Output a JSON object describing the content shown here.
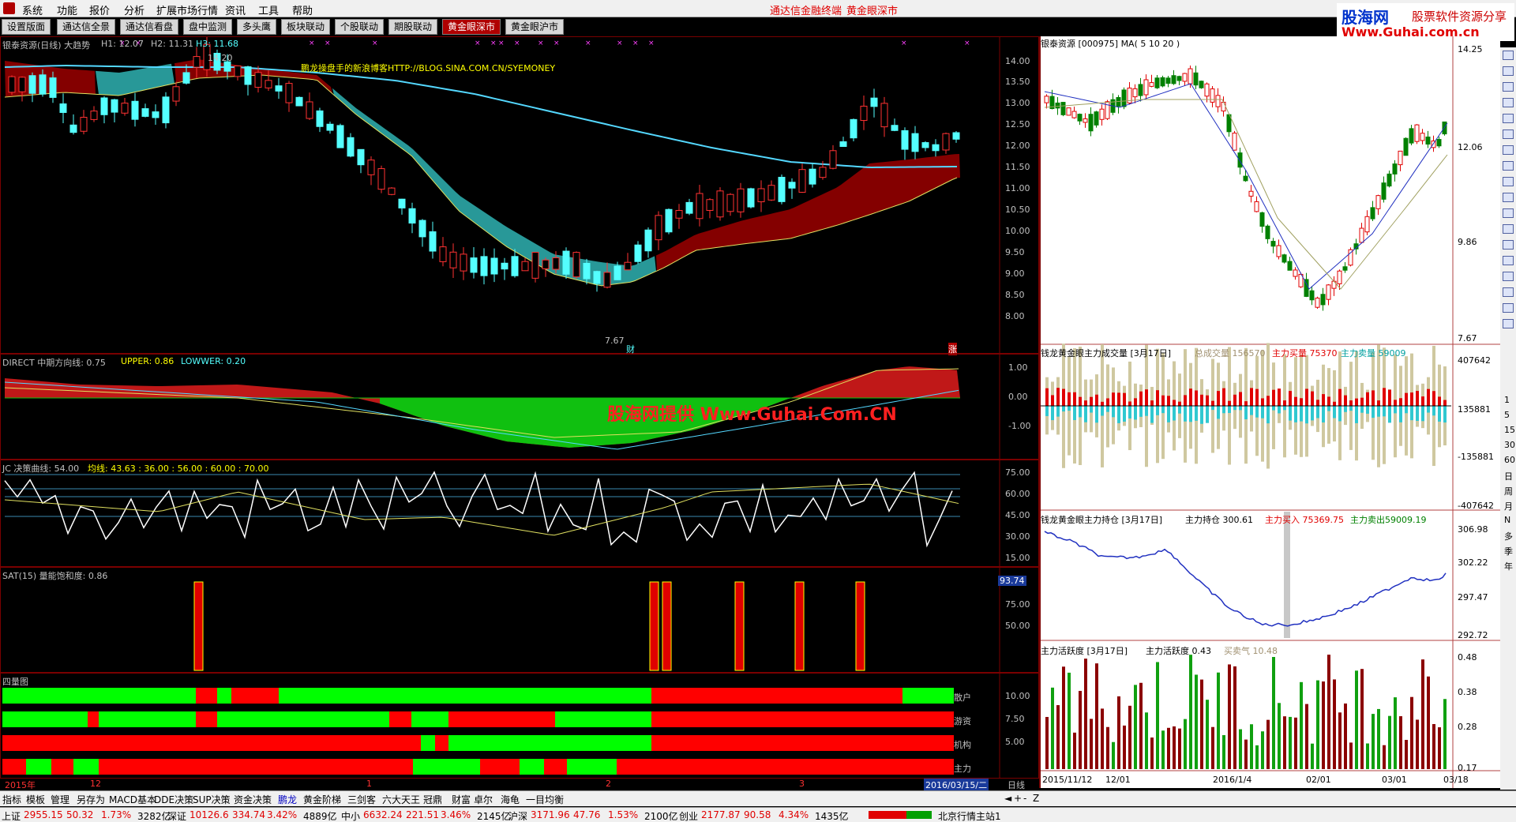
{
  "menu": {
    "items": [
      "系统",
      "功能",
      "报价",
      "分析",
      "扩展市场行情",
      "资讯",
      "工具",
      "帮助"
    ],
    "center_title_1": "通达信金融终端",
    "center_title_2": "黄金眼深市"
  },
  "brand": {
    "logo": "股海网",
    "slogan": "股票软件资源分享",
    "url": "Www.Guhai.com.cn"
  },
  "tabs": [
    "设置版面",
    "通达信全景",
    "通达信看盘",
    "盘中监测",
    "多头鹰",
    "板块联动",
    "个股联动",
    "期股联动",
    "黄金眼深市",
    "黄金眼沪市"
  ],
  "active_tab": "黄金眼深市",
  "main_chart": {
    "header": "银泰资源(日线) 大趋势",
    "h1": "H1: 12.07",
    "h2": "H2: 11.31",
    "h3": "H3: 11.68",
    "annotation": "鹏龙操盘手的新浪博客HTTP://BLOG.SINA.COM.CN/SYEMONEY",
    "high_label": "14.20",
    "low_label": "7.67",
    "marker_cai": "财",
    "marker_zhang": "涨",
    "y_axis": [
      "14.00",
      "13.50",
      "13.00",
      "12.50",
      "12.00",
      "11.50",
      "11.00",
      "10.50",
      "10.00",
      "9.50",
      "9.00",
      "8.50",
      "8.00"
    ]
  },
  "direct_panel": {
    "title": "DIRECT  中期方向线: 0.75",
    "upper": "UPPER: 0.86",
    "lower": "LOWWER: 0.20",
    "y_axis": [
      "1.00",
      "0.00",
      "-1.00"
    ],
    "watermark": "股海网提供 Www.Guhai.Com.CN"
  },
  "jc_panel": {
    "title": "JC  决策曲线: 54.00",
    "avg": "均线: 43.63 : 36.00 : 56.00 : 60.00 : 70.00",
    "y_axis": [
      "75.00",
      "60.00",
      "45.00",
      "30.00",
      "15.00"
    ]
  },
  "sat_panel": {
    "title": "SAT(15)  量能饱和度: 0.86",
    "y_axis": [
      "75.00",
      "50.00"
    ],
    "value_badge": "93.74"
  },
  "four_panel": {
    "title": "四量图",
    "rows": [
      "散户",
      "游资",
      "机构",
      "主力"
    ],
    "y_axis": [
      "10.00",
      "7.50",
      "5.00"
    ]
  },
  "date_bar": {
    "labels": [
      "2015年",
      "12",
      "1",
      "2",
      "3"
    ],
    "current": "2016/03/15/二",
    "period": "日线"
  },
  "right_pane": {
    "kline_title": "银泰资源 [000975] MA( 5 10 20 )",
    "kline_axis": [
      "14.25",
      "12.06",
      "9.86",
      "7.67"
    ],
    "vol_title": "钱龙黄金眼主力成交量 [3月17日]",
    "vol_total": "总成交量 156570",
    "vol_buy": "主力买量 75370",
    "vol_sell": "主力卖量 59009",
    "vol_axis": [
      "407642",
      "135881",
      "-135881",
      "-407642"
    ],
    "hold_title": "钱龙黄金眼主力持仓 [3月17日]",
    "hold_value": "主力持仓 300.61",
    "hold_buy": "主力买入 75369.75",
    "hold_sell": "主力卖出59009.19",
    "hold_axis": [
      "306.98",
      "302.22",
      "297.47",
      "292.72"
    ],
    "act_title": "主力活跃度 [3月17日]",
    "act_value": "主力活跃度 0.43",
    "act_mood": "买卖气 10.48",
    "act_axis": [
      "0.48",
      "0.38",
      "0.28",
      "0.17"
    ],
    "dates": [
      "2015/11/12",
      "12/01",
      "2016/1/4",
      "02/01",
      "03/01",
      "03/18"
    ]
  },
  "vtool_labels": [
    "1",
    "5",
    "15",
    "30",
    "60",
    "日",
    "周",
    "月",
    "N",
    "多",
    "季",
    "年"
  ],
  "bottom_tabs": [
    "指标",
    "模板",
    "管理",
    "另存为",
    "MACD基本",
    "DDE决策",
    "SUP决策",
    "资金决策",
    "鹏龙",
    "黄金阶梯",
    "三剑客",
    "六大天王",
    "冠鼎",
    "财富",
    "卓尔",
    "海龟",
    "一目均衡"
  ],
  "status": [
    {
      "name": "上证",
      "price": "2955.15",
      "chg": "50.32",
      "pct": "1.73%",
      "amt": "3282亿"
    },
    {
      "name": "深证",
      "price": "10126.6",
      "chg": "334.74",
      "pct": "3.42%",
      "amt": "4889亿"
    },
    {
      "name": "中小",
      "price": "6632.24",
      "chg": "221.51",
      "pct": "3.46%",
      "amt": "2145亿"
    },
    {
      "name": "沪深",
      "price": "3171.96",
      "chg": "47.76",
      "pct": "1.53%",
      "amt": "2100亿"
    },
    {
      "name": "创业",
      "price": "2177.87",
      "chg": "90.58",
      "pct": "4.34%",
      "amt": "1435亿"
    }
  ],
  "station": "北京行情主站1",
  "colors": {
    "up": "#ff3232",
    "down": "#54ffff",
    "panel_border": "#7a0000",
    "accent": "#b00000"
  }
}
